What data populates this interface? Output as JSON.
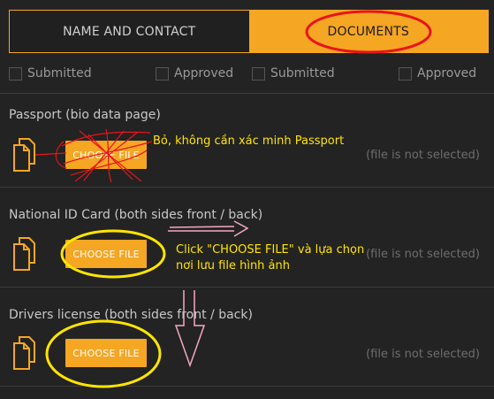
{
  "tabs": [
    {
      "label": "NAME AND CONTACT",
      "active": false
    },
    {
      "label": "DOCUMENTS",
      "active": true
    }
  ],
  "checkboxes": [
    {
      "label": "Submitted",
      "checked": false
    },
    {
      "label": "Approved",
      "checked": false
    },
    {
      "label": "Submitted",
      "checked": false
    },
    {
      "label": "Approved",
      "checked": false
    }
  ],
  "sections": [
    {
      "title": "Passport (bio data page)",
      "button": "CHOOSE FILE",
      "status": "(file is not selected)"
    },
    {
      "title": "National ID Card (both sides front / back)",
      "button": "CHOOSE FILE",
      "status": "(file is not selected)"
    },
    {
      "title": "Drivers license (both sides front / back)",
      "button": "CHOOSE FILE",
      "status": "(file is not selected)"
    }
  ],
  "annotations": {
    "skip_passport": "Bỏ, không cần xác minh Passport",
    "click_line1": "Click \"CHOOSE FILE\" và lựa chọn",
    "click_line2": "nơi lưu file hình ảnh"
  },
  "colors": {
    "accent": "#f5a623",
    "annotation_yellow": "#ffe500",
    "annotation_red": "#e8141c",
    "annotation_pink": "#f4a9c0"
  },
  "icons": [
    "file-stack-icon"
  ]
}
